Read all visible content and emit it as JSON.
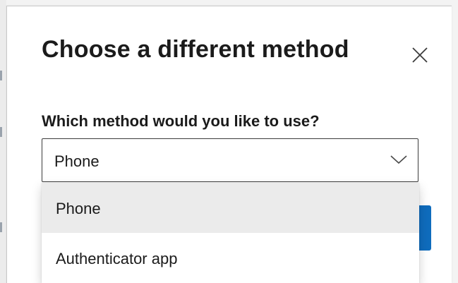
{
  "dialog": {
    "title": "Choose a different method",
    "close_icon": "close-icon",
    "prompt": "Which method would you like to use?"
  },
  "method_select": {
    "value": "Phone",
    "chevron_icon": "chevron-down-icon",
    "options": [
      {
        "label": "Phone",
        "selected": true
      },
      {
        "label": "Authenticator app",
        "selected": false
      }
    ]
  },
  "colors": {
    "primary_button": "#0f6cbd",
    "selected_option_bg": "#ebebeb",
    "text": "#1b1b1b"
  }
}
